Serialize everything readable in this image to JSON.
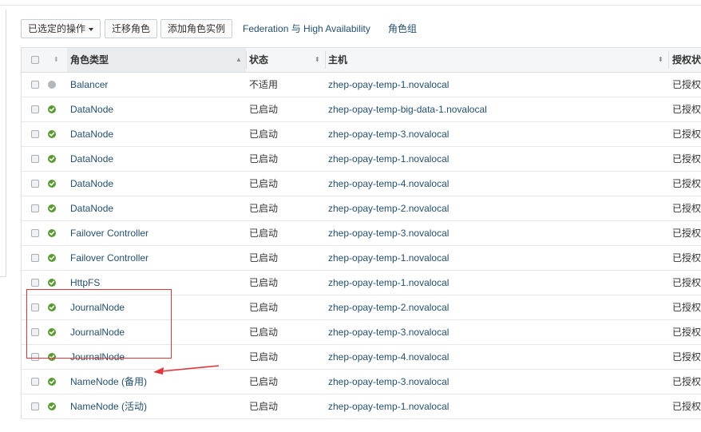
{
  "toolbar": {
    "actions_label": "已选定的操作",
    "migrate_label": "迁移角色",
    "add_label": "添加角色实例",
    "federation_label": "Federation 与 High Availability",
    "role_groups_label": "角色组"
  },
  "table": {
    "columns": {
      "type": "角色类型",
      "state": "状态",
      "host": "主机",
      "auth": "授权状"
    },
    "rows": [
      {
        "status": "na",
        "type": "Balancer",
        "state": "不适用",
        "host": "zhep-opay-temp-1.novalocal",
        "auth": "已授权"
      },
      {
        "status": "ok",
        "type": "DataNode",
        "state": "已启动",
        "host": "zhep-opay-temp-big-data-1.novalocal",
        "auth": "已授权"
      },
      {
        "status": "ok",
        "type": "DataNode",
        "state": "已启动",
        "host": "zhep-opay-temp-3.novalocal",
        "auth": "已授权"
      },
      {
        "status": "ok",
        "type": "DataNode",
        "state": "已启动",
        "host": "zhep-opay-temp-1.novalocal",
        "auth": "已授权"
      },
      {
        "status": "ok",
        "type": "DataNode",
        "state": "已启动",
        "host": "zhep-opay-temp-4.novalocal",
        "auth": "已授权"
      },
      {
        "status": "ok",
        "type": "DataNode",
        "state": "已启动",
        "host": "zhep-opay-temp-2.novalocal",
        "auth": "已授权"
      },
      {
        "status": "ok",
        "type": "Failover Controller",
        "state": "已启动",
        "host": "zhep-opay-temp-3.novalocal",
        "auth": "已授权"
      },
      {
        "status": "ok",
        "type": "Failover Controller",
        "state": "已启动",
        "host": "zhep-opay-temp-1.novalocal",
        "auth": "已授权"
      },
      {
        "status": "ok",
        "type": "HttpFS",
        "state": "已启动",
        "host": "zhep-opay-temp-1.novalocal",
        "auth": "已授权"
      },
      {
        "status": "ok",
        "type": "JournalNode",
        "state": "已启动",
        "host": "zhep-opay-temp-2.novalocal",
        "auth": "已授权"
      },
      {
        "status": "ok",
        "type": "JournalNode",
        "state": "已启动",
        "host": "zhep-opay-temp-3.novalocal",
        "auth": "已授权"
      },
      {
        "status": "ok",
        "type": "JournalNode",
        "state": "已启动",
        "host": "zhep-opay-temp-4.novalocal",
        "auth": "已授权"
      },
      {
        "status": "ok",
        "type": "NameNode (备用)",
        "state": "已启动",
        "host": "zhep-opay-temp-3.novalocal",
        "auth": "已授权"
      },
      {
        "status": "ok",
        "type": "NameNode (活动)",
        "state": "已启动",
        "host": "zhep-opay-temp-1.novalocal",
        "auth": "已授权"
      }
    ]
  },
  "colors": {
    "link": "#24506e",
    "status_ok": "#5b9a33",
    "status_na": "#b3b7bb",
    "annotation_red": "#e0353b"
  },
  "icons": {
    "status_ok": "check-circle-icon",
    "status_na": "gray-dot-icon",
    "sort": "sort-arrow-icon"
  }
}
